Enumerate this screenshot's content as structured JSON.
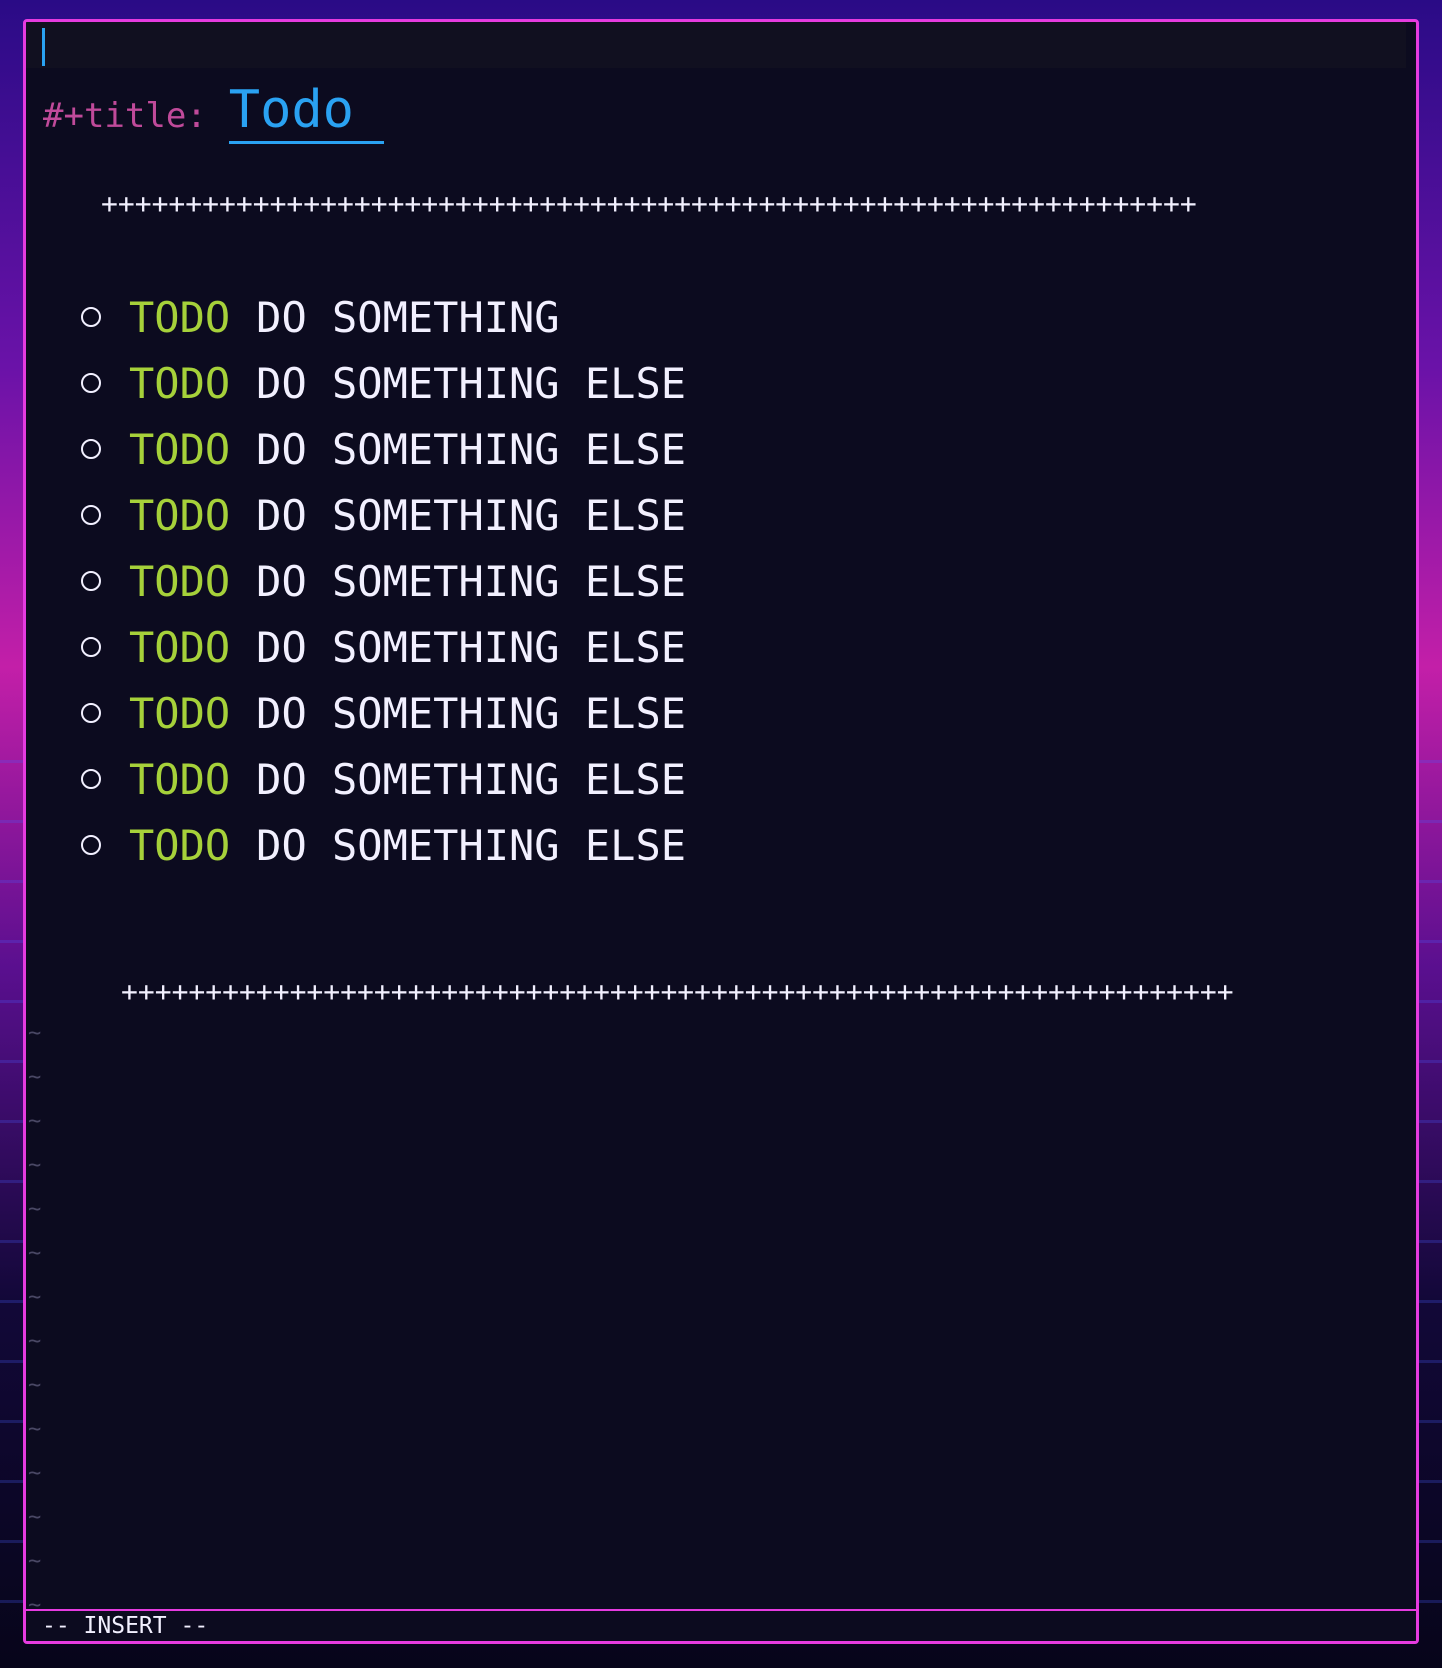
{
  "editor": {
    "title_key": "#+title:",
    "title_value": "Todo",
    "separator_top": "+++++++++++++++++++++++++++++++++++++++++++++++++++++++++++++++++",
    "separator_bottom": "++++++++++++++++++++++++++++++++++++++++++++++++++++++++++++++++++",
    "todos": [
      {
        "keyword": "TODO",
        "text": "DO SOMETHING"
      },
      {
        "keyword": "TODO",
        "text": "DO SOMETHING ELSE"
      },
      {
        "keyword": "TODO",
        "text": "DO SOMETHING ELSE"
      },
      {
        "keyword": "TODO",
        "text": "DO SOMETHING ELSE"
      },
      {
        "keyword": "TODO",
        "text": "DO SOMETHING ELSE"
      },
      {
        "keyword": "TODO",
        "text": "DO SOMETHING ELSE"
      },
      {
        "keyword": "TODO",
        "text": "DO SOMETHING ELSE"
      },
      {
        "keyword": "TODO",
        "text": "DO SOMETHING ELSE"
      },
      {
        "keyword": "TODO",
        "text": "DO SOMETHING ELSE"
      }
    ],
    "empty_line_marker": "~"
  },
  "statusbar": {
    "mode": "-- INSERT --"
  },
  "colors": {
    "border": "#e63be0",
    "background": "#0c0b1f",
    "title": "#2aa2f2",
    "title_key": "#c04a9a",
    "todo_keyword": "#a6d13a",
    "text": "#f2f0ff"
  }
}
